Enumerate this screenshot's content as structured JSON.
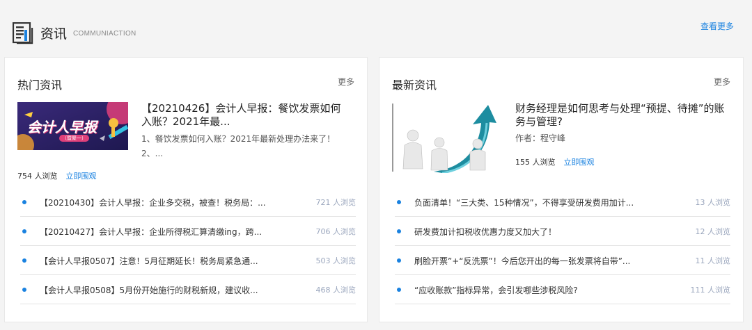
{
  "header": {
    "icon": "news-doc-icon",
    "title": "资讯",
    "subtitle": "COMMUNIACTION",
    "more_label": "查看更多"
  },
  "hot": {
    "title": "热门资讯",
    "more_label": "更多",
    "feature": {
      "image_text": "会计人早报",
      "image_subtext": "（暨聚一）",
      "title": "【20210426】会计人早报：餐饮发票如何入账？2021年最...",
      "desc": "1、餐饮发票如何入账？2021年最新处理办法来了！2、...",
      "views": "754 人浏览",
      "watch_label": "立即围观"
    },
    "items": [
      {
        "title": "【20210430】会计人早报：企业多交税，被查！税务局：...",
        "views": "721 人浏览"
      },
      {
        "title": "【20210427】会计人早报：企业所得税汇算清缴ing，跨...",
        "views": "706 人浏览"
      },
      {
        "title": "【会计人早报0507】注意！5月征期延长！税务局紧急通...",
        "views": "503 人浏览"
      },
      {
        "title": "【会计人早报0508】5月份开始施行的财税新规，建议收...",
        "views": "468 人浏览"
      }
    ]
  },
  "latest": {
    "title": "最新资讯",
    "more_label": "更多",
    "feature": {
      "title": "财务经理是如何思考与处理“预提、待摊”的账务与管理?",
      "author": "作者：程守峰",
      "views": "155 人浏览",
      "watch_label": "立即围观"
    },
    "items": [
      {
        "title": "负面清单！“三大类、15种情况”，不得享受研发费用加计...",
        "views": "13 人浏览"
      },
      {
        "title": "研发费加计扣税收优惠力度又加大了！",
        "views": "12 人浏览"
      },
      {
        "title": "刷脸开票”+“反洗票”！今后您开出的每一张发票将自带”...",
        "views": "11 人浏览"
      },
      {
        "title": "“应收账款”指标异常，会引发哪些涉税风险?",
        "views": "111 人浏览"
      }
    ]
  },
  "colors": {
    "accent": "#1a82e0",
    "views_gray": "#9aa6bd",
    "banner_bg": "#2a2160",
    "arrow": "#1d8da0"
  }
}
